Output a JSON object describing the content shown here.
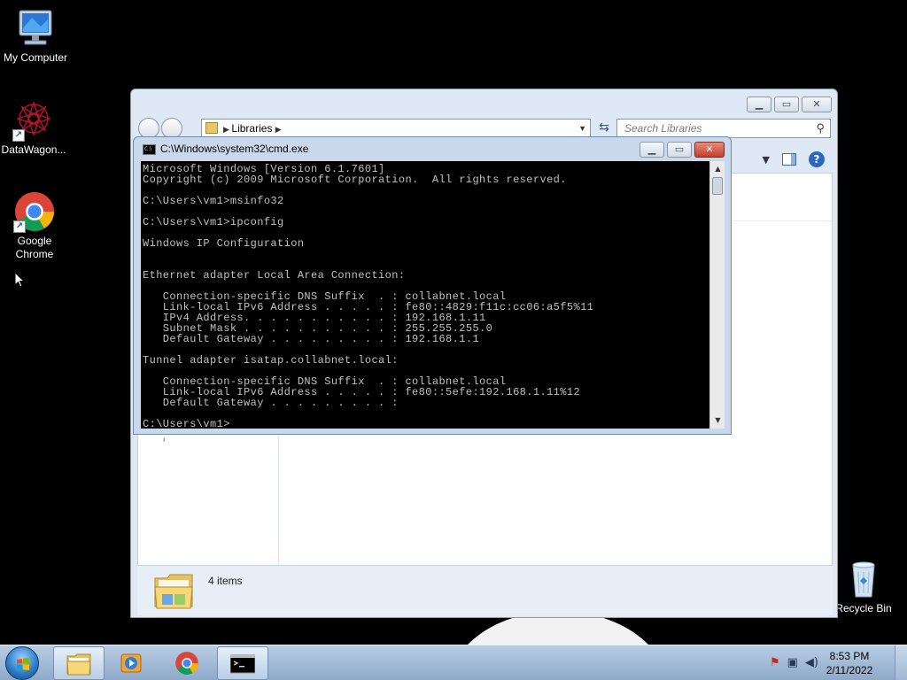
{
  "desktop": {
    "icons": [
      {
        "label": "My Computer",
        "icon": "computer-icon"
      },
      {
        "label": "DataWagon...",
        "icon": "datawagon-icon"
      },
      {
        "label": "Google Chrome",
        "icon": "chrome-icon"
      },
      {
        "label": "Recycle Bin",
        "icon": "recycle-bin-icon"
      }
    ]
  },
  "explorer": {
    "address": "Libraries",
    "search_placeholder": "Search Libraries",
    "item_count": "4 items"
  },
  "cmd": {
    "title": "C:\\Windows\\system32\\cmd.exe",
    "lines": [
      "Microsoft Windows [Version 6.1.7601]",
      "Copyright (c) 2009 Microsoft Corporation.  All rights reserved.",
      "",
      "C:\\Users\\vm1>msinfo32",
      "",
      "C:\\Users\\vm1>ipconfig",
      "",
      "Windows IP Configuration",
      "",
      "",
      "Ethernet adapter Local Area Connection:",
      "",
      "   Connection-specific DNS Suffix  . : collabnet.local",
      "   Link-local IPv6 Address . . . . . : fe80::4829:f11c:cc06:a5f5%11",
      "   IPv4 Address. . . . . . . . . . . : 192.168.1.11",
      "   Subnet Mask . . . . . . . . . . . : 255.255.255.0",
      "   Default Gateway . . . . . . . . . : 192.168.1.1",
      "",
      "Tunnel adapter isatap.collabnet.local:",
      "",
      "   Connection-specific DNS Suffix  . : collabnet.local",
      "   Link-local IPv6 Address . . . . . : fe80::5efe:192.168.1.11%12",
      "   Default Gateway . . . . . . . . . :",
      "",
      "C:\\Users\\vm1>"
    ]
  },
  "taskbar": {
    "buttons": [
      {
        "icon": "explorer-folder-icon",
        "active": true
      },
      {
        "icon": "media-player-icon",
        "active": false
      },
      {
        "icon": "chrome-icon",
        "active": false
      },
      {
        "icon": "cmd-icon",
        "active": true
      }
    ],
    "time": "8:53 PM",
    "date": "2/11/2022"
  },
  "colors": {
    "console_bg": "#000000",
    "console_text": "#c0c0c0",
    "taskbar": "#a9c0db",
    "close_red": "#c4402a"
  }
}
